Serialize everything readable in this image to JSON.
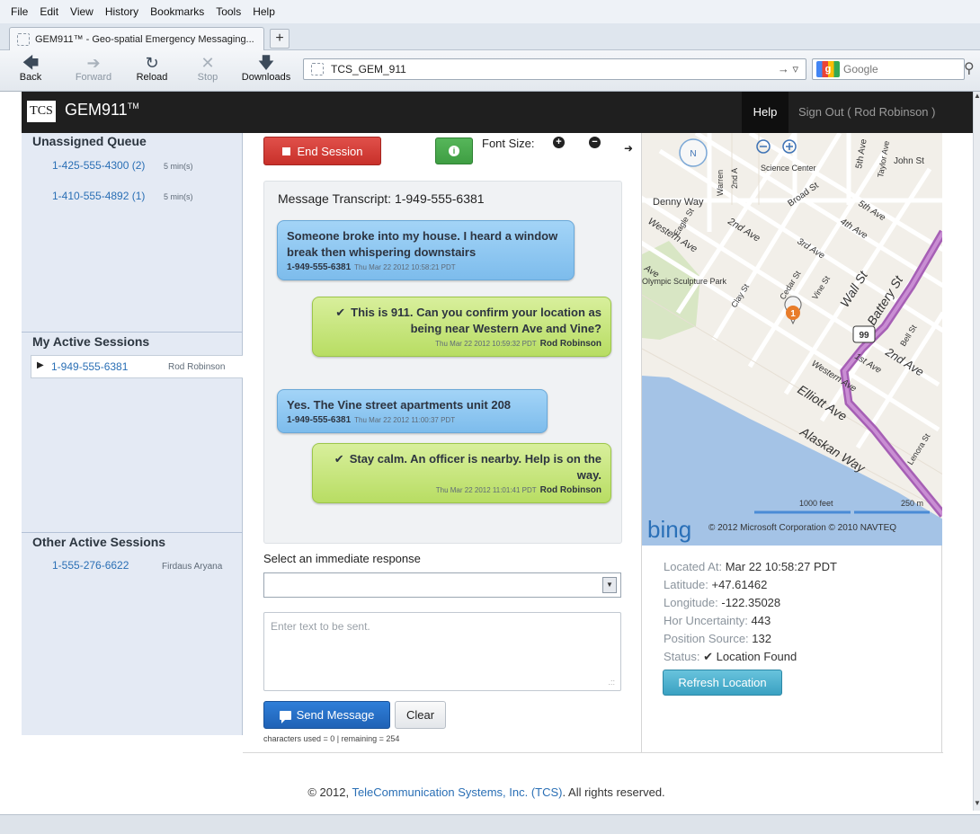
{
  "browser": {
    "menu": [
      "File",
      "Edit",
      "View",
      "History",
      "Bookmarks",
      "Tools",
      "Help"
    ],
    "tab_title": "GEM911™ - Geo-spatial Emergency Messaging...",
    "new_tab": "+",
    "nav": {
      "back": "Back",
      "forward": "Forward",
      "reload": "Reload",
      "stop": "Stop",
      "downloads": "Downloads"
    },
    "url": "TCS_GEM_911",
    "search_placeholder": "Google"
  },
  "app": {
    "logo": "TCS",
    "brand": "GEM911",
    "brand_mark": "TM",
    "help": "Help",
    "sign_out": "Sign Out ( Rod Robinson )"
  },
  "left": {
    "unassigned_title": "Unassigned Queue",
    "unassigned": [
      {
        "number": "1-425-555-4300 (2)",
        "time": "5 min(s)"
      },
      {
        "number": "1-410-555-4892 (1)",
        "time": "5 min(s)"
      }
    ],
    "active_title": "My Active Sessions",
    "active": [
      {
        "number": "1-949-555-6381",
        "agent": "Rod Robinson"
      }
    ],
    "other_title": "Other Active Sessions",
    "other": [
      {
        "number": "1-555-276-6622",
        "agent": "Firdaus Aryana"
      }
    ]
  },
  "controls": {
    "end_session": "End Session",
    "info": "i",
    "font_size_label": "Font Size:",
    "font_plus": "+",
    "font_minus": "−",
    "collapse": "➜"
  },
  "transcript": {
    "title": "Message Transcript: 1-949-555-6381",
    "messages": [
      {
        "side": "caller",
        "text": "Someone broke into my house. I heard a window break then whispering downstairs",
        "sender": "1-949-555-6381",
        "time": "Thu Mar 22 2012 10:58:21 PDT"
      },
      {
        "side": "agent",
        "text": "This is 911. Can you confirm your location as being near Western Ave and Vine?",
        "sender": "Rod Robinson",
        "time": "Thu Mar 22 2012 10:59:32 PDT"
      },
      {
        "side": "caller",
        "text": "Yes. The Vine street apartments unit 208",
        "sender": "1-949-555-6381",
        "time": "Thu Mar 22 2012 11:00:37 PDT"
      },
      {
        "side": "agent",
        "text": "Stay calm. An officer is nearby. Help is on the way.",
        "sender": "Rod Robinson",
        "time": "Thu Mar 22 2012 11:01:41 PDT"
      }
    ],
    "check": "✔"
  },
  "response": {
    "select_label": "Select an immediate response",
    "selected": "",
    "text_placeholder": "Enter text to be sent.",
    "send": "Send Message",
    "clear": "Clear",
    "counter": "characters used = 0 | remaining = 254"
  },
  "map": {
    "streets": [
      "John St",
      "2nd A",
      "Warren",
      "Denny Way",
      "Broad St",
      "5th Ave",
      "Taylor Ave",
      "Western Ave",
      "Eagle St",
      "2nd Ave",
      "3rd Ave",
      "4th Ave",
      "5th Ave",
      "Olympic Sculpture Park",
      "Clay St",
      "Cedar St",
      "Vine St",
      "Wall St",
      "Battery St",
      "Bell St",
      "2nd Ave",
      "1st Ave",
      "Western Ave",
      "Elliott Ave",
      "Alaskan Way",
      "Lenora St",
      "Science Center",
      "Ave",
      "99"
    ],
    "marker": "1",
    "scale_feet": "1000 feet",
    "scale_m": "250 m",
    "bing": "bing",
    "copyright": "© 2012 Microsoft Corporation   © 2010 NAVTEQ",
    "compass": "N"
  },
  "location": {
    "located_label": "Located At:",
    "located_value": "Mar 22 10:58:27 PDT",
    "lat_label": "Latitude:",
    "lat_value": "+47.61462",
    "lon_label": "Longitude:",
    "lon_value": "-122.35028",
    "unc_label": "Hor Uncertainty:",
    "unc_value": "443",
    "src_label": "Position Source:",
    "src_value": "132",
    "status_label": "Status:",
    "status_value": "Location Found",
    "refresh": "Refresh Location"
  },
  "footer": {
    "prefix": "© 2012, ",
    "company": "TeleCommunication Systems, Inc. (TCS)",
    "suffix": ". All rights reserved."
  }
}
